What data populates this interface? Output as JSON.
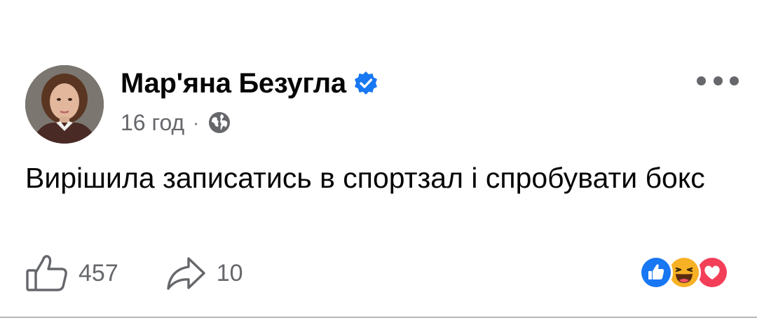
{
  "post": {
    "author": "Мар'яна Безугла",
    "verified_icon": "verified-badge-icon",
    "time": "16 год",
    "separator": "·",
    "audience_icon": "globe-icon",
    "text": "Вирішила записатись в спортзал і спробувати бокс"
  },
  "actions": {
    "like_icon": "thumbs-up-icon",
    "like_count": "457",
    "share_icon": "share-arrow-icon",
    "share_count": "10"
  },
  "reactions": [
    "like-reaction-icon",
    "haha-reaction-icon",
    "love-reaction-icon"
  ],
  "colors": {
    "text": "#050505",
    "secondary": "#65676b",
    "brand_blue": "#1877f2",
    "love_red": "#f33e58",
    "haha_yellow": "#f7b125"
  }
}
